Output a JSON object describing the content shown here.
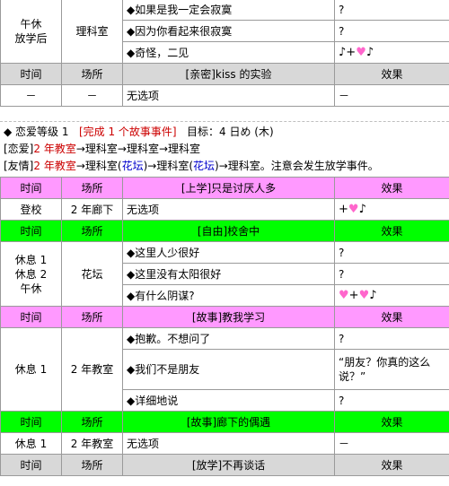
{
  "top_table": {
    "row1_time": "午休",
    "row1_time2": "放学后",
    "row1_place": "理科室",
    "choices": [
      {
        "text": "◆如果是我一定会寂寞",
        "effect": "?"
      },
      {
        "text": "◆因为你看起来很寂寞",
        "effect": "?"
      },
      {
        "text": "◆奇怪，二见",
        "effect": "♪+♡♪"
      }
    ]
  },
  "kiss_section": {
    "headers": [
      "时间",
      "场所",
      "[亲密]kiss 的实验",
      "效果"
    ],
    "row": {
      "time": "－",
      "place": "－",
      "content": "无选项",
      "effect": "－"
    }
  },
  "love_level": {
    "line1_prefix": "◆ 恋爱等级 1",
    "line1_task": "[完成 1 个故事事件]",
    "line1_target": "目标：4 日め (木)",
    "line2_label": "[恋爱]",
    "line2_parts": [
      "2 年教室",
      "→理科室→理科室→理科室"
    ],
    "line3_label": "[友情]",
    "line3_parts": [
      "2 年教室",
      "→理科室(",
      "花坛",
      ")→理科室(",
      "花坛",
      ")→理科室。注意会发生放学事件。"
    ]
  },
  "events": [
    {
      "header": [
        "时间",
        "场所",
        "[上学]只是讨厌人多",
        "效果"
      ],
      "color": "pink",
      "rows": [
        {
          "time": "登校",
          "place": "2 年廊下",
          "content": "无选项",
          "effect": "+♡♪"
        }
      ]
    },
    {
      "header": [
        "时间",
        "场所",
        "[自由]校舍中",
        "效果"
      ],
      "color": "green",
      "times": [
        "休息 1",
        "休息 2",
        "午休"
      ],
      "place": "花坛",
      "choices": [
        {
          "text": "◆这里人少很好",
          "effect": "?"
        },
        {
          "text": "◆这里没有太阳很好",
          "effect": "?"
        },
        {
          "text": "◆有什么阴谋?",
          "effect": "♡+♡♪"
        }
      ]
    },
    {
      "header": [
        "时间",
        "场所",
        "[故事]教我学习",
        "效果"
      ],
      "color": "pink",
      "time": "休息 1",
      "place": "2 年教室",
      "choices": [
        {
          "text": "◆抱歉。不想问了",
          "effect": "?"
        },
        {
          "text": "◆我们不是朋友",
          "effect": "“朋友？你真的这么说？”"
        },
        {
          "text": "◆详细地说",
          "effect": "?"
        }
      ]
    },
    {
      "header": [
        "时间",
        "场所",
        "[故事]廊下的偶遇",
        "效果"
      ],
      "color": "green",
      "rows": [
        {
          "time": "休息 1",
          "place": "2 年教室",
          "content": "无选项",
          "effect": "－"
        }
      ]
    },
    {
      "header": [
        "时间",
        "场所",
        "[放学]不再谈话",
        "效果"
      ],
      "color": "gray"
    }
  ],
  "colors": {
    "pink": "#ff99ff",
    "green": "#00ff00",
    "gray": "#d8d8d8",
    "red": "#cc0000",
    "blue": "#0000cc",
    "heart": "#ff66cc"
  }
}
